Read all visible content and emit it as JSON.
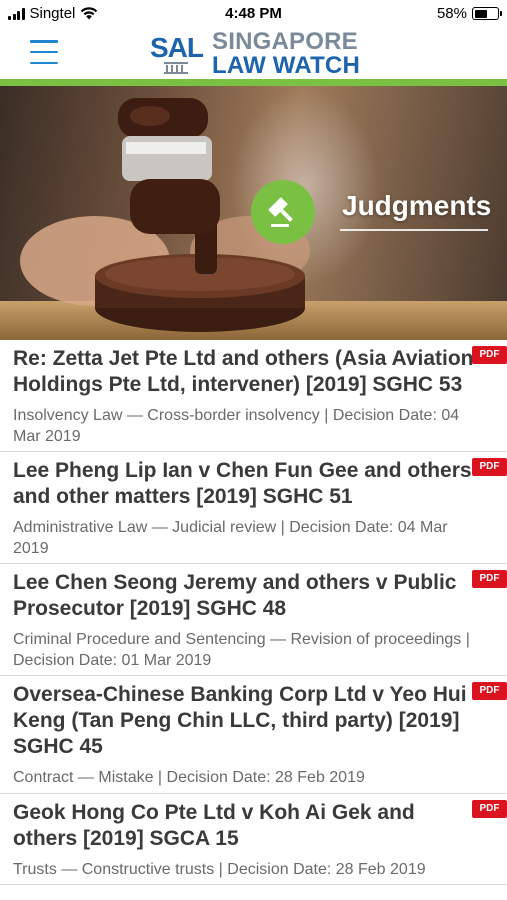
{
  "status_bar": {
    "carrier": "Singtel",
    "time": "4:48 PM",
    "battery": "58%",
    "battery_level": 0.58
  },
  "header": {
    "logo_abbr": "SAL",
    "logo_line1": "SINGAPORE",
    "logo_line2": "LAW WATCH",
    "menu_icon": "hamburger-menu-icon"
  },
  "banner": {
    "title": "Judgments",
    "icon": "gavel-icon"
  },
  "colors": {
    "brand_blue": "#1e63ad",
    "accent_green": "#7ac143",
    "pdf_red": "#d9131f"
  },
  "judgments": [
    {
      "title": "Re: Zetta Jet Pte Ltd and others (Asia Aviation Holdings Pte Ltd, intervener) [2019] SGHC 53",
      "meta": "Insolvency Law — Cross-border insolvency | Decision Date: 04 Mar 2019",
      "badge": "PDF"
    },
    {
      "title": "Lee Pheng Lip Ian v Chen Fun Gee and others and other matters [2019] SGHC 51",
      "meta": "Administrative Law — Judicial review | Decision Date: 04 Mar 2019",
      "badge": "PDF"
    },
    {
      "title": "Lee Chen Seong Jeremy and others v Public Prosecutor [2019] SGHC 48",
      "meta": "Criminal Procedure and Sentencing — Revision of proceedings | Decision Date: 01 Mar 2019",
      "badge": "PDF"
    },
    {
      "title": "Oversea-Chinese Banking Corp Ltd v Yeo Hui Keng (Tan Peng Chin LLC, third party) [2019] SGHC 45",
      "meta": "Contract — Mistake | Decision Date: 28 Feb 2019",
      "badge": "PDF"
    },
    {
      "title": "Geok Hong Co Pte Ltd v Koh Ai Gek and others [2019] SGCA 15",
      "meta": "Trusts — Constructive trusts | Decision Date: 28 Feb 2019",
      "badge": "PDF"
    }
  ]
}
